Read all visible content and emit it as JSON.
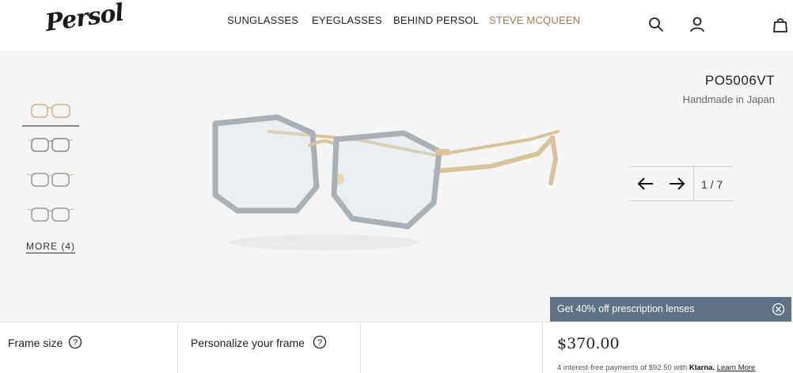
{
  "header": {
    "logo_text": "Persol",
    "nav": [
      "SUNGLASSES",
      "EYEGLASSES",
      "BEHIND PERSOL",
      "STEVE MCQUEEN"
    ],
    "icons": [
      "search-icon",
      "account-icon",
      "bag-icon"
    ]
  },
  "gallery": {
    "thumbnail_count": 4,
    "more_label": "MORE (4)"
  },
  "product": {
    "name": "PO5006VT",
    "subtitle": "Handmade in Japan",
    "pager": "1 / 7",
    "frame_color": "#d9c49a",
    "lens_rim_color": "#a9b0b6"
  },
  "promo": {
    "text": "Get 40% off prescription lenses",
    "bg_color": "#5e7185"
  },
  "bottom_bar": {
    "frame_size_label": "Frame size",
    "personalize_label": "Personalize your frame",
    "price": "$370.00",
    "klarna_prefix": "4 interest-free payments of $92.50 with",
    "klarna_brand": "Klarna.",
    "learn_more": "Learn More"
  }
}
